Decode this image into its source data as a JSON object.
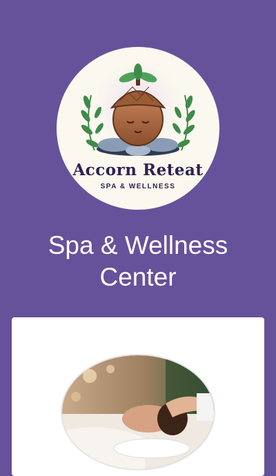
{
  "logo": {
    "brand": "Accorn Reteat",
    "tagline": "SPA & WELLNESS",
    "icon": "acorn-on-stones-logo"
  },
  "page": {
    "title": "Spa & Wellness Center"
  },
  "card": {
    "image_icon": "facial-massage-photo"
  },
  "colors": {
    "background": "#65529a",
    "card": "#ffffff",
    "logo_bg": "#fbf9ef",
    "logo_text": "#2d2250"
  }
}
